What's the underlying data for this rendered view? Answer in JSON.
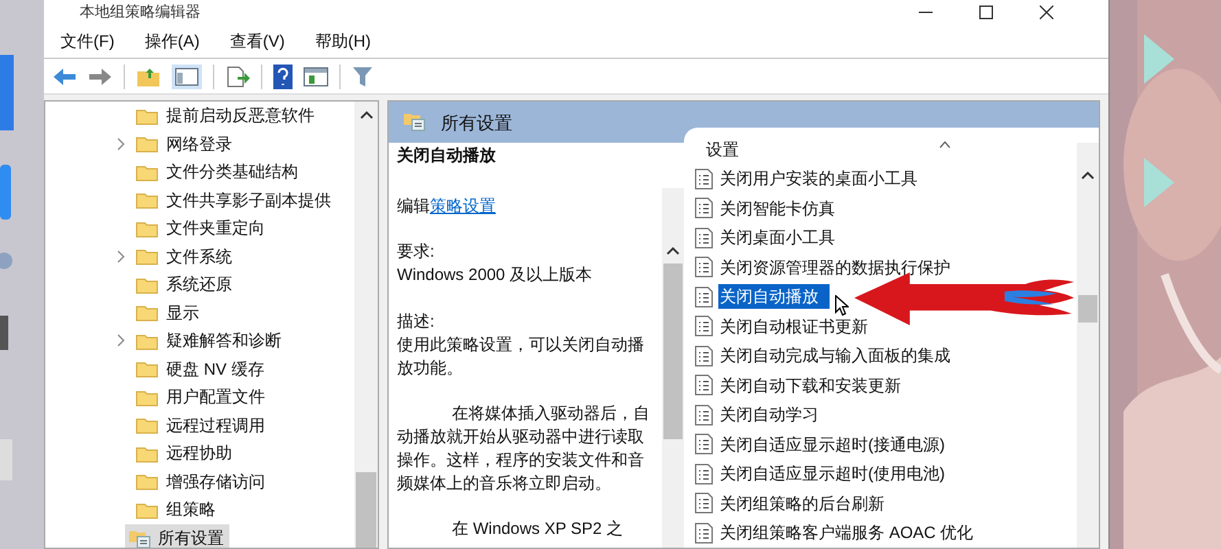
{
  "window": {
    "title": "本地组策略编辑器"
  },
  "menu": [
    "文件(F)",
    "操作(A)",
    "查看(V)",
    "帮助(H)"
  ],
  "tree": {
    "children": [
      {
        "label": "提前启动反恶意软件",
        "expandable": false,
        "selected": false
      },
      {
        "label": "网络登录",
        "expandable": true,
        "selected": false
      },
      {
        "label": "文件分类基础结构",
        "expandable": false,
        "selected": false
      },
      {
        "label": "文件共享影子副本提供",
        "expandable": false,
        "selected": false
      },
      {
        "label": "文件夹重定向",
        "expandable": false,
        "selected": false
      },
      {
        "label": "文件系统",
        "expandable": true,
        "selected": false
      },
      {
        "label": "系统还原",
        "expandable": false,
        "selected": false
      },
      {
        "label": "显示",
        "expandable": false,
        "selected": false
      },
      {
        "label": "疑难解答和诊断",
        "expandable": true,
        "selected": false
      },
      {
        "label": "硬盘 NV 缓存",
        "expandable": false,
        "selected": false
      },
      {
        "label": "用户配置文件",
        "expandable": false,
        "selected": false
      },
      {
        "label": "远程过程调用",
        "expandable": false,
        "selected": false
      },
      {
        "label": "远程协助",
        "expandable": false,
        "selected": false
      },
      {
        "label": "增强存储访问",
        "expandable": false,
        "selected": false
      },
      {
        "label": "组策略",
        "expandable": false,
        "selected": false
      }
    ],
    "items": [
      {
        "label": "所有设置",
        "selected": true
      }
    ]
  },
  "details": {
    "header": "所有设置",
    "title": "关闭自动播放",
    "edit_prefix": "编辑",
    "edit_link": "策略设置",
    "requirement_label": "要求:",
    "requirement": "Windows 2000 及以上版本",
    "description_label": "描述:",
    "paragraphs": [
      "使用此策略设置，可以关闭自动播放功能。",
      "在将媒体插入驱动器后，自动播放就开始从驱动器中进行读取操作。这样，程序的安装文件和音频媒体上的音乐将立即启动。",
      "在 Windows XP SP2 之"
    ]
  },
  "settings": {
    "column": "设置",
    "items": [
      {
        "label": "关闭用户安装的桌面小工具",
        "selected": false
      },
      {
        "label": "关闭智能卡仿真",
        "selected": false
      },
      {
        "label": "关闭桌面小工具",
        "selected": false
      },
      {
        "label": "关闭资源管理器的数据执行保护",
        "selected": false
      },
      {
        "label": "关闭自动播放",
        "selected": true
      },
      {
        "label": "关闭自动根证书更新",
        "selected": false
      },
      {
        "label": "关闭自动完成与输入面板的集成",
        "selected": false
      },
      {
        "label": "关闭自动下载和安装更新",
        "selected": false
      },
      {
        "label": "关闭自动学习",
        "selected": false
      },
      {
        "label": "关闭自适应显示超时(接通电源)",
        "selected": false
      },
      {
        "label": "关闭自适应显示超时(使用电池)",
        "selected": false
      },
      {
        "label": "关闭组策略的后台刷新",
        "selected": false
      },
      {
        "label": "关闭组策略客户端服务 AOAC 优化",
        "selected": false
      }
    ]
  }
}
